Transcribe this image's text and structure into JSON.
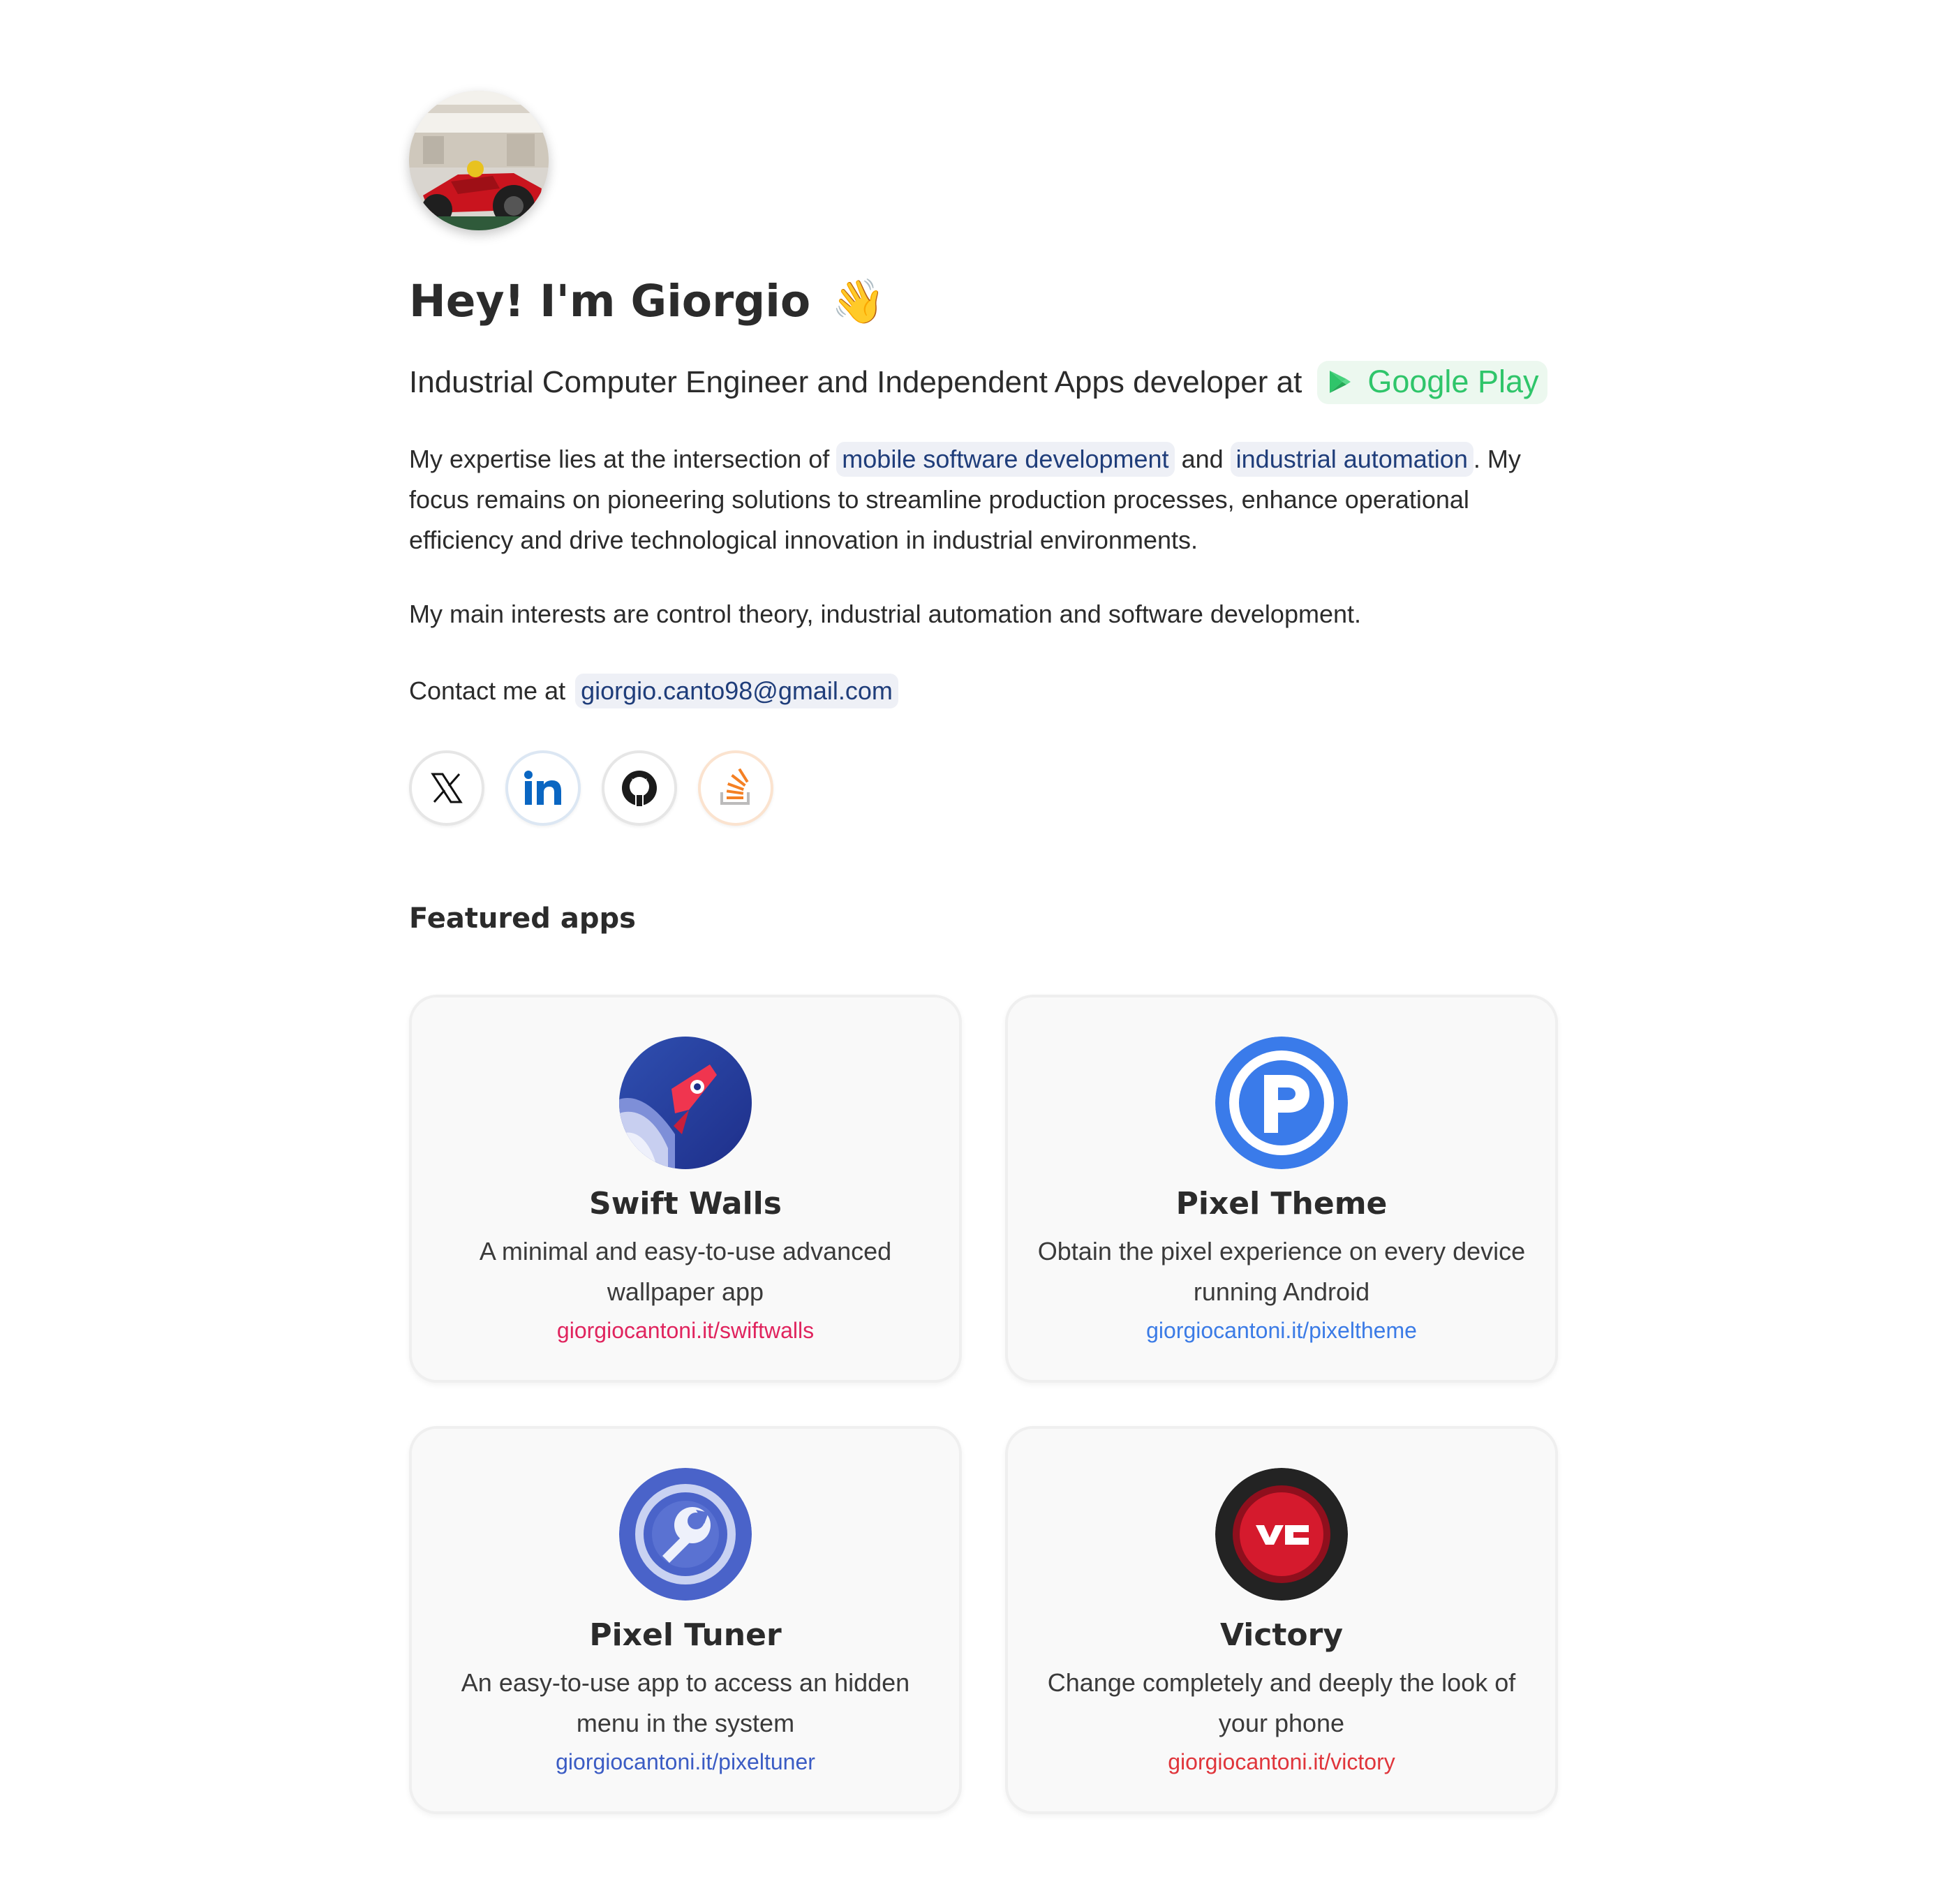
{
  "hero": {
    "greeting": "Hey! I'm Giorgio",
    "wave_emoji": "👋"
  },
  "subtitle": {
    "text": "Industrial Computer Engineer and Independent Apps developer at",
    "store_label": "Google Play",
    "store_icon": "google-play-icon",
    "store_color": "#2fc56a"
  },
  "about": {
    "intro": "My expertise lies at the intersection of",
    "tag1": "mobile software development",
    "and": "and",
    "tag2": "industrial automation",
    "rest": ". My focus remains on pioneering solutions to streamline production processes, enhance operational efficiency and drive technological innovation in industrial environments.",
    "interests": "My main interests are control theory, industrial automation and software development."
  },
  "contact": {
    "label": "Contact me at",
    "email": "giorgio.canto98@gmail.com"
  },
  "socials": [
    {
      "name": "X",
      "icon": "x-icon"
    },
    {
      "name": "LinkedIn",
      "icon": "linkedin-icon"
    },
    {
      "name": "GitHub",
      "icon": "github-icon"
    },
    {
      "name": "Stack Overflow",
      "icon": "stackoverflow-icon"
    }
  ],
  "featured": {
    "title": "Featured apps",
    "apps": [
      {
        "name": "Swift Walls",
        "desc": "A minimal and easy-to-use advanced wallpaper app",
        "link": "giorgiocantoni.it/swiftwalls",
        "color": "#e0245e"
      },
      {
        "name": "Pixel Theme",
        "desc": "Obtain the pixel experience on every device running Android",
        "link": "giorgiocantoni.it/pixeltheme",
        "color": "#3b7be6"
      },
      {
        "name": "Pixel Tuner",
        "desc": "An easy-to-use app to access an hidden menu in the system",
        "link": "giorgiocantoni.it/pixeltuner",
        "color": "#3b5cc4"
      },
      {
        "name": "Victory",
        "desc": "Change completely and deeply the look of your phone",
        "link": "giorgiocantoni.it/victory",
        "color": "#e0353b"
      }
    ]
  }
}
